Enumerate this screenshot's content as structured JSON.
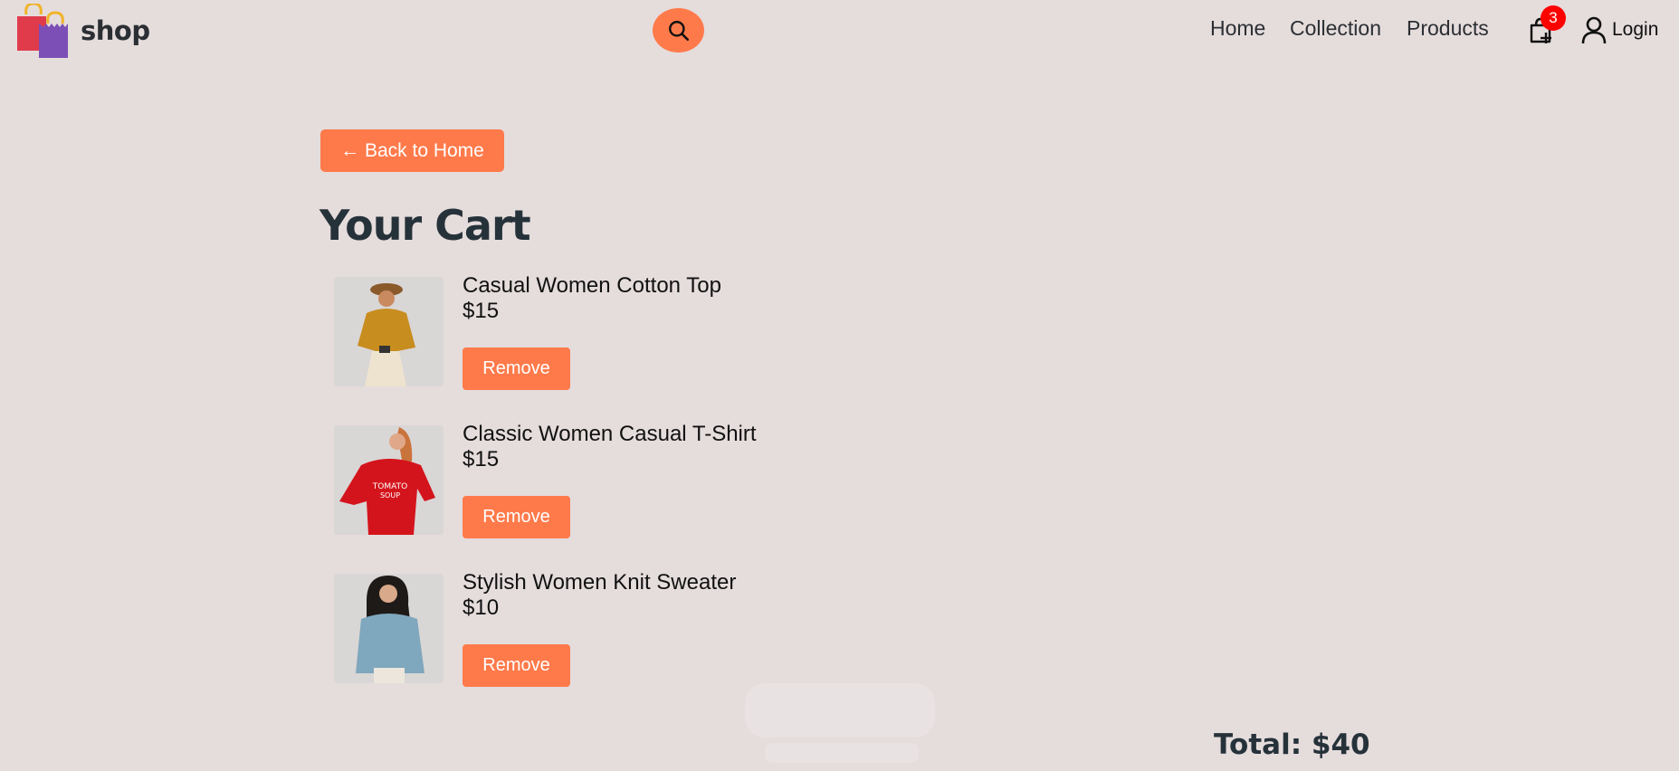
{
  "header": {
    "brand": "shop",
    "nav": {
      "home": "Home",
      "collection": "Collection",
      "products": "Products"
    },
    "cart_count": "3",
    "login": "Login"
  },
  "icons": {
    "logo": "shopping-bags-logo",
    "search": "search-icon",
    "cart": "shopping-bag-plus-icon",
    "user": "user-icon"
  },
  "colors": {
    "background": "#e5dcdc",
    "accent": "#ff7a4a",
    "badge": "#ff0000",
    "heading": "#26323a"
  },
  "main": {
    "back_label": "← Back to Home",
    "title": "Your Cart",
    "items": [
      {
        "name": "Casual Women Cotton Top",
        "price": "$15",
        "remove_label": "Remove"
      },
      {
        "name": "Classic Women Casual T-Shirt",
        "price": "$15",
        "remove_label": "Remove"
      },
      {
        "name": "Stylish Women Knit Sweater",
        "price": "$10",
        "remove_label": "Remove"
      }
    ],
    "total": "Total: $40"
  }
}
